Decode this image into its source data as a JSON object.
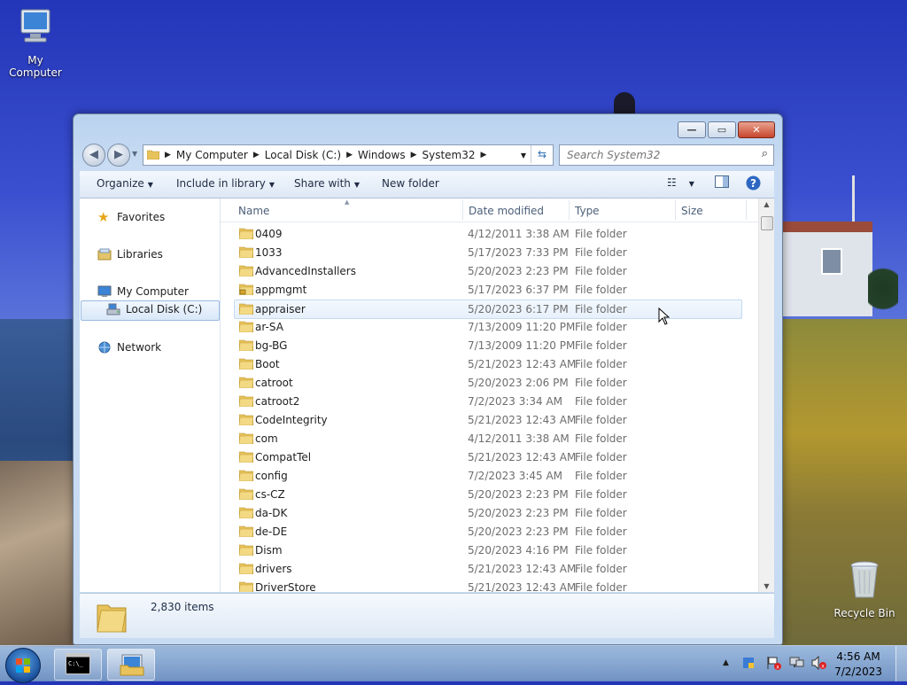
{
  "desktop": {
    "icons": [
      {
        "label": "My Computer"
      },
      {
        "label": "Recycle Bin"
      }
    ]
  },
  "window": {
    "caption_buttons": {
      "minimize": "—",
      "maximize": "▭",
      "close": "✕"
    },
    "address": {
      "breadcrumbs": [
        "My Computer",
        "Local Disk (C:)",
        "Windows",
        "System32"
      ]
    },
    "search": {
      "placeholder": "Search System32"
    },
    "toolbar": {
      "organize": "Organize",
      "include_in_library": "Include in library",
      "share_with": "Share with",
      "new_folder": "New folder"
    },
    "nav_pane": {
      "favorites": "Favorites",
      "libraries": "Libraries",
      "my_computer": "My Computer",
      "local_disk": "Local Disk (C:)",
      "network": "Network"
    },
    "columns": {
      "name": "Name",
      "date_modified": "Date modified",
      "type": "Type",
      "size": "Size"
    },
    "files": [
      {
        "name": "0409",
        "date": "4/12/2011 3:38 AM",
        "type": "File folder"
      },
      {
        "name": "1033",
        "date": "5/17/2023 7:33 PM",
        "type": "File folder"
      },
      {
        "name": "AdvancedInstallers",
        "date": "5/20/2023 2:23 PM",
        "type": "File folder"
      },
      {
        "name": "appmgmt",
        "date": "5/17/2023 6:37 PM",
        "type": "File folder"
      },
      {
        "name": "appraiser",
        "date": "5/20/2023 6:17 PM",
        "type": "File folder"
      },
      {
        "name": "ar-SA",
        "date": "7/13/2009 11:20 PM",
        "type": "File folder"
      },
      {
        "name": "bg-BG",
        "date": "7/13/2009 11:20 PM",
        "type": "File folder"
      },
      {
        "name": "Boot",
        "date": "5/21/2023 12:43 AM",
        "type": "File folder"
      },
      {
        "name": "catroot",
        "date": "5/20/2023 2:06 PM",
        "type": "File folder"
      },
      {
        "name": "catroot2",
        "date": "7/2/2023 3:34 AM",
        "type": "File folder"
      },
      {
        "name": "CodeIntegrity",
        "date": "5/21/2023 12:43 AM",
        "type": "File folder"
      },
      {
        "name": "com",
        "date": "4/12/2011 3:38 AM",
        "type": "File folder"
      },
      {
        "name": "CompatTel",
        "date": "5/21/2023 12:43 AM",
        "type": "File folder"
      },
      {
        "name": "config",
        "date": "7/2/2023 3:45 AM",
        "type": "File folder"
      },
      {
        "name": "cs-CZ",
        "date": "5/20/2023 2:23 PM",
        "type": "File folder"
      },
      {
        "name": "da-DK",
        "date": "5/20/2023 2:23 PM",
        "type": "File folder"
      },
      {
        "name": "de-DE",
        "date": "5/20/2023 2:23 PM",
        "type": "File folder"
      },
      {
        "name": "Dism",
        "date": "5/20/2023 4:16 PM",
        "type": "File folder"
      },
      {
        "name": "drivers",
        "date": "5/21/2023 12:43 AM",
        "type": "File folder"
      },
      {
        "name": "DriverStore",
        "date": "5/21/2023 12:43 AM",
        "type": "File folder"
      }
    ],
    "details": {
      "item_count": "2,830 items"
    }
  },
  "taskbar": {
    "time": "4:56 AM",
    "date": "7/2/2023"
  }
}
